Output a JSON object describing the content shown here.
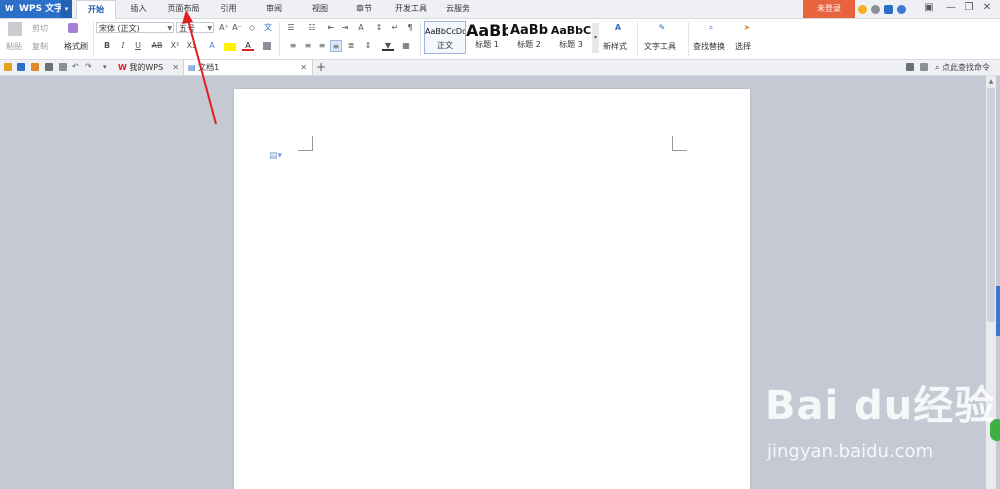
{
  "app": {
    "logo": "W",
    "name": "WPS 文字",
    "dropdown": "▾"
  },
  "menu_tabs": [
    "开始",
    "插入",
    "页面布局",
    "引用",
    "审阅",
    "视图",
    "章节",
    "开发工具",
    "云服务"
  ],
  "login_label": "未登录",
  "window_controls": {
    "minimize": "—",
    "restore": "❐",
    "close": "✕"
  },
  "clipboard": {
    "paste": "粘贴",
    "cut": "剪切",
    "copy": "复制",
    "format_painter": "格式刷"
  },
  "font": {
    "family": "宋体 (正文)",
    "size": "五号",
    "bold": "B",
    "italic": "I",
    "underline": "U",
    "strike": "AB",
    "superscript": "X²",
    "subscript": "X₂"
  },
  "style_gallery": [
    {
      "sample": "AaBbCcDd",
      "label": "正文"
    },
    {
      "sample": "AaBb",
      "label": "标题 1"
    },
    {
      "sample": "AaBb",
      "label": "标题 2"
    },
    {
      "sample": "AaBbC",
      "label": "标题 3"
    }
  ],
  "ribbon_right": {
    "new_style": "新样式",
    "text_tools": "文字工具",
    "find_replace": "查找替换",
    "select": "选择"
  },
  "doc_tabs": [
    {
      "label": "我的WPS",
      "close": "✕"
    },
    {
      "label": "文档1",
      "close": "✕"
    }
  ],
  "new_tab": "+",
  "search_command": "点此查找命令",
  "watermark": {
    "brand": "Bai du经验",
    "url": "jingyan.baidu.com"
  },
  "colors": {
    "accent": "#2b6fc9",
    "login": "#e8643f",
    "annotation_arrow": "#e02020"
  }
}
